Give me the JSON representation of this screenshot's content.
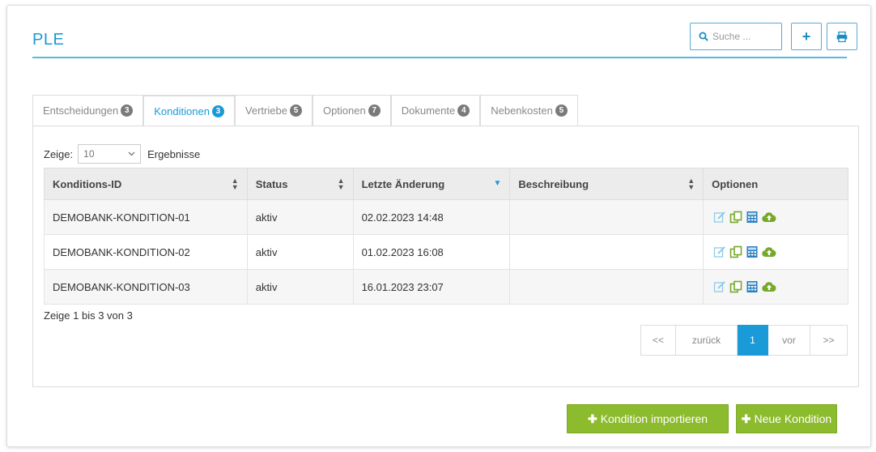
{
  "header": {
    "title": "PLE",
    "search_placeholder": "Suche ...",
    "add_label": "+",
    "accent": "#1a9ad6"
  },
  "tabs": [
    {
      "label": "Entscheidungen",
      "count": "3",
      "active": false
    },
    {
      "label": "Konditionen",
      "count": "3",
      "active": true
    },
    {
      "label": "Vertriebe",
      "count": "5",
      "active": false
    },
    {
      "label": "Optionen",
      "count": "7",
      "active": false
    },
    {
      "label": "Dokumente",
      "count": "4",
      "active": false
    },
    {
      "label": "Nebenkosten",
      "count": "5",
      "active": false
    }
  ],
  "length_control": {
    "prefix": "Zeige:",
    "value": "10",
    "suffix": "Ergebnisse"
  },
  "table": {
    "columns": [
      "Konditions-ID",
      "Status",
      "Letzte Änderung",
      "Beschreibung",
      "Optionen"
    ],
    "rows": [
      {
        "id": "DEMOBANK-KONDITION-01",
        "status": "aktiv",
        "changed": "02.02.2023 14:48",
        "description": ""
      },
      {
        "id": "DEMOBANK-KONDITION-02",
        "status": "aktiv",
        "changed": "01.02.2023 16:08",
        "description": ""
      },
      {
        "id": "DEMOBANK-KONDITION-03",
        "status": "aktiv",
        "changed": "16.01.2023 23:07",
        "description": ""
      }
    ],
    "row_icons": [
      "edit-icon",
      "copy-icon",
      "calculator-icon",
      "cloud-upload-icon"
    ]
  },
  "info_text": "Zeige 1 bis 3 von 3",
  "pagination": {
    "first": "<<",
    "prev": "zurück",
    "current": "1",
    "next": "vor",
    "last": ">>"
  },
  "actions": {
    "import_label": "Kondition importieren",
    "new_label": "Neue Kondition",
    "color": "#8dbb2e"
  }
}
